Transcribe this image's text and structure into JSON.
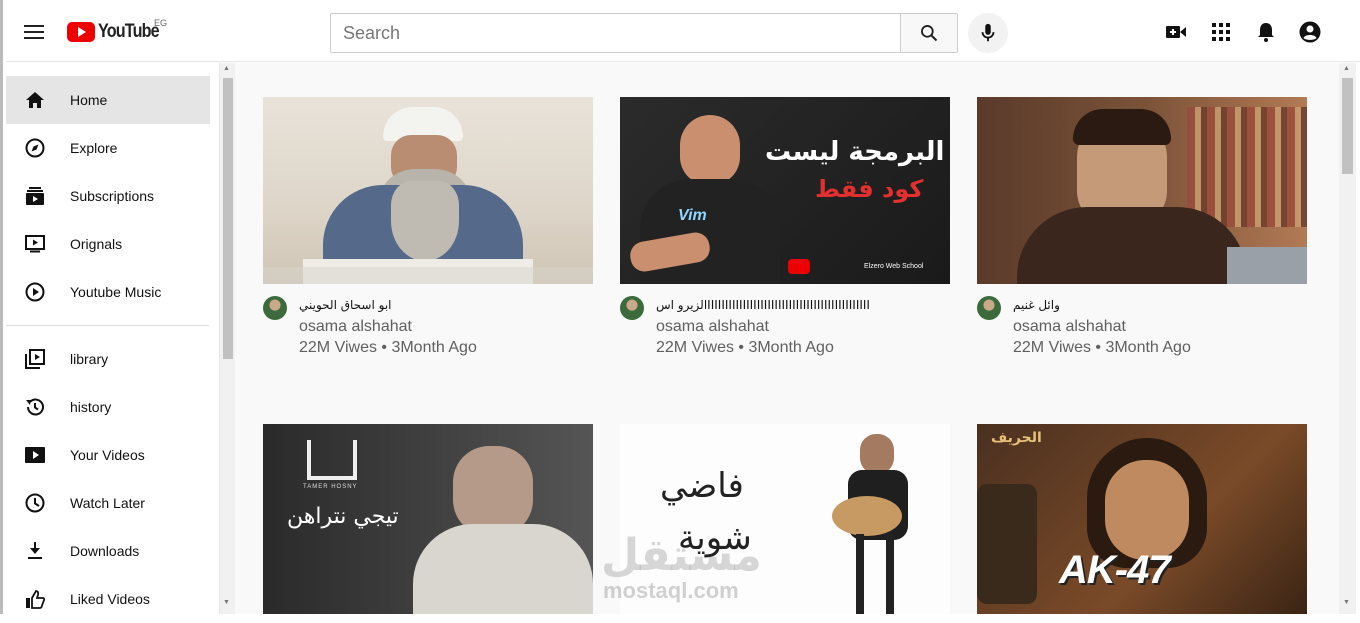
{
  "header": {
    "logo_text": "YouTube",
    "country_code": "EG",
    "search_placeholder": "Search"
  },
  "sidebar": {
    "items": [
      {
        "label": "Home",
        "icon": "home-icon",
        "active": true
      },
      {
        "label": "Explore",
        "icon": "compass-icon"
      },
      {
        "label": "Subscriptions",
        "icon": "subscriptions-icon"
      },
      {
        "label": "Orignals",
        "icon": "originals-icon"
      },
      {
        "label": "Youtube Music",
        "icon": "music-icon"
      }
    ],
    "items2": [
      {
        "label": "library",
        "icon": "library-icon"
      },
      {
        "label": "history",
        "icon": "history-icon"
      },
      {
        "label": "Your Videos",
        "icon": "your-videos-icon"
      },
      {
        "label": "Watch Later",
        "icon": "clock-icon"
      },
      {
        "label": "Downloads",
        "icon": "download-icon"
      },
      {
        "label": "Liked Videos",
        "icon": "thumbs-up-icon"
      }
    ]
  },
  "videos": [
    {
      "title": "ابو اسحاق الحويني",
      "channel": "osama alshahat",
      "stats": "22M Viwes • 3Month Ago"
    },
    {
      "title": "الزيرو اسIIIIIIIIIIIIIIIIIIIIIIIIIIIIIIIIIIIIIIIIIIIIII",
      "channel": "osama alshahat",
      "stats": "22M Viwes • 3Month Ago"
    },
    {
      "title": "وائل غنيم",
      "channel": "osama alshahat",
      "stats": "22M Viwes • 3Month Ago"
    },
    {
      "title": "",
      "channel": "",
      "stats": ""
    },
    {
      "title": "",
      "channel": "",
      "stats": ""
    },
    {
      "title": "",
      "channel": "",
      "stats": ""
    }
  ],
  "thumb_texts": {
    "v2_line1": "البرمجة ليست",
    "v2_line2": "كود فقط",
    "v2_brand": "Elzero Web School",
    "v2_shirt": "Vim",
    "v4_text": "تيجي نتراهن",
    "v4_logo": "TAMER HOSNY",
    "v5_line1": "فاضي",
    "v5_line2": "شوية",
    "v6_text": "AK-47",
    "v6_badge": "الحريف"
  },
  "watermark": {
    "ar": "مستقل",
    "en": "mostaql.com"
  },
  "colors": {
    "brand_red": "#ff0000",
    "active_bg": "#e5e5e5",
    "meta_gray": "#606060"
  }
}
